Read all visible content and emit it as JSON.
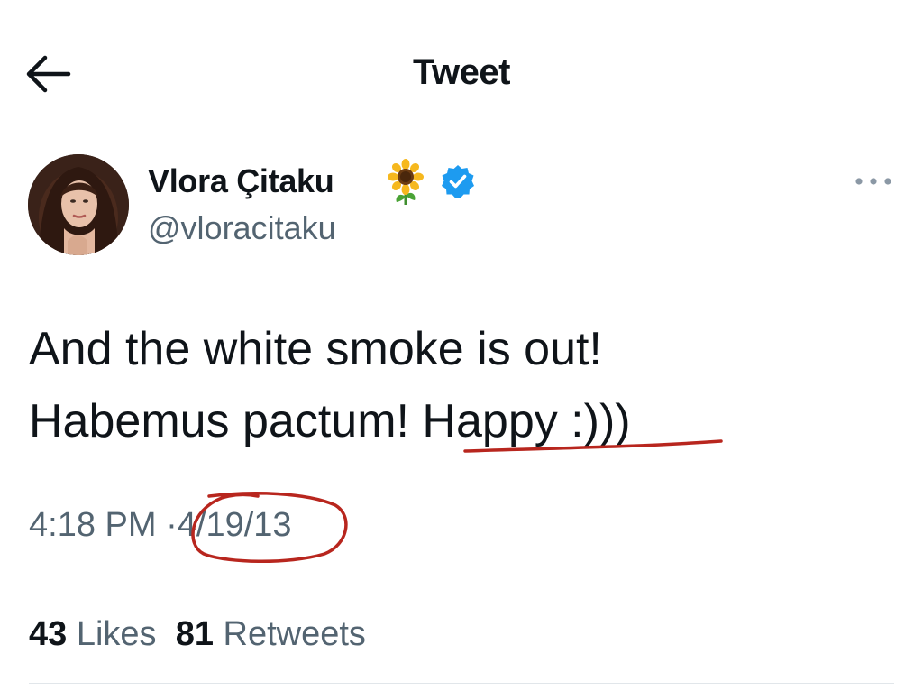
{
  "header": {
    "title": "Tweet",
    "back_icon": "arrow-left-icon"
  },
  "author": {
    "display_name": "Vlora Çitaku",
    "name_emoji": "sunflower-icon",
    "verified_icon": "verified-badge-icon",
    "handle": "@vloracitaku",
    "more_icon": "more-horizontal-icon"
  },
  "tweet": {
    "text_line1": "And the white smoke is out!",
    "text_line2_prefix": "Habemus pactum! ",
    "text_line2_highlight": "Happy :)))",
    "time": "4:18 PM",
    "separator": "·",
    "date": "4/19/13"
  },
  "stats": {
    "likes_count": "43",
    "likes_label": "Likes",
    "retweets_count": "81",
    "retweets_label": "Retweets"
  },
  "colors": {
    "text": "#0f1419",
    "secondary": "#536471",
    "verified_blue": "#1d9bf0",
    "annotation_red": "#b8261e"
  }
}
